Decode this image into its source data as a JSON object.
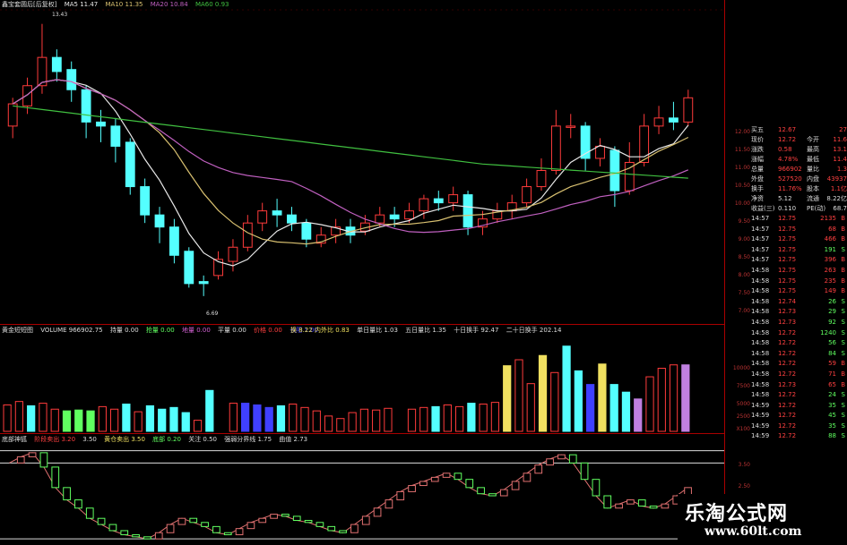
{
  "price_header": {
    "name": "鑫宝套圆后[后复权]",
    "ma5": "MA5 11.47",
    "ma10": "MA10 11.35",
    "ma20": "MA20 10.84",
    "ma60": "MA60 0.93",
    "high_label": "13.43",
    "low_label": "6.69"
  },
  "volume_header": {
    "name": "黄金短短图",
    "volume": "VOLUME 966902.75",
    "items": [
      "持量 0.00",
      "抢量 0.00",
      "地量 0.00",
      "平量 0.00",
      "价格 0.00",
      "长阳 1.00"
    ],
    "turnover": [
      "换手 8.72",
      "换 8.22 内外比 0.83",
      "单日量比 1.03",
      "五日量比 1.35",
      "十日换手 92.47",
      "二十日换手 202.14"
    ]
  },
  "indicator_header": {
    "name": "底部神狐",
    "items": [
      "阶段卖出 3.20",
      "3.50",
      "黄仓卖出 3.50",
      "底部 0.20",
      "关注 0.50",
      "强弱分界线 1.75",
      "曲值 2.73"
    ]
  },
  "axis": {
    "price_ticks": [
      "12.00",
      "11.50",
      "11.00",
      "10.50",
      "10.00",
      "9.50",
      "9.00",
      "8.50",
      "8.00",
      "7.50",
      "7.00"
    ],
    "volume_ticks": [
      "10000",
      "7500",
      "5000",
      "2500",
      "X100"
    ],
    "indicator_ticks": [
      "3.50",
      "2.50",
      "1.50"
    ]
  },
  "quote": [
    {
      "label": "买五",
      "val": "12.67",
      "right": "27"
    },
    {
      "label": "现价",
      "val": "12.72",
      "mid": "今开",
      "right": "11.6"
    },
    {
      "label": "涨跌",
      "val": "0.58",
      "mid": "最高",
      "right": "13.1"
    },
    {
      "label": "涨幅",
      "val": "4.78%",
      "mid": "最低",
      "right": "11.4"
    },
    {
      "label": "总量",
      "val": "966902",
      "mid": "量比",
      "right": "1.3"
    },
    {
      "label": "外盘",
      "val": "527520",
      "mid": "内盘",
      "right": "43937"
    },
    {
      "label": "换手",
      "val": "11.76%",
      "mid": "股本",
      "right": "1.1亿"
    },
    {
      "label": "净资",
      "val": "5.12",
      "mid": "流通",
      "right": "8.22亿"
    },
    {
      "label": "收益(三)",
      "val": "0.110",
      "mid": "PE(动)",
      "right": "68.7"
    }
  ],
  "ticks": [
    {
      "t": "14:57",
      "p": "12.75",
      "v": "2135",
      "s": "B"
    },
    {
      "t": "14:57",
      "p": "12.75",
      "v": "68",
      "s": "B"
    },
    {
      "t": "14:57",
      "p": "12.75",
      "v": "466",
      "s": "B"
    },
    {
      "t": "14:57",
      "p": "12.75",
      "v": "191",
      "s": "S"
    },
    {
      "t": "14:57",
      "p": "12.75",
      "v": "396",
      "s": "B"
    },
    {
      "t": "14:58",
      "p": "12.75",
      "v": "263",
      "s": "B"
    },
    {
      "t": "14:58",
      "p": "12.75",
      "v": "235",
      "s": "B"
    },
    {
      "t": "14:58",
      "p": "12.75",
      "v": "149",
      "s": "B"
    },
    {
      "t": "14:58",
      "p": "12.74",
      "v": "26",
      "s": "S"
    },
    {
      "t": "14:58",
      "p": "12.73",
      "v": "29",
      "s": "S"
    },
    {
      "t": "14:58",
      "p": "12.73",
      "v": "92",
      "s": "S"
    },
    {
      "t": "14:58",
      "p": "12.72",
      "v": "1240",
      "s": "S"
    },
    {
      "t": "14:58",
      "p": "12.72",
      "v": "56",
      "s": "S"
    },
    {
      "t": "14:58",
      "p": "12.72",
      "v": "84",
      "s": "S"
    },
    {
      "t": "14:58",
      "p": "12.72",
      "v": "59",
      "s": "B"
    },
    {
      "t": "14:58",
      "p": "12.72",
      "v": "71",
      "s": "B"
    },
    {
      "t": "14:58",
      "p": "12.73",
      "v": "65",
      "s": "B"
    },
    {
      "t": "14:58",
      "p": "12.72",
      "v": "24",
      "s": "S"
    },
    {
      "t": "14:59",
      "p": "12.72",
      "v": "35",
      "s": "S"
    },
    {
      "t": "14:59",
      "p": "12.72",
      "v": "45",
      "s": "S"
    },
    {
      "t": "14:59",
      "p": "12.72",
      "v": "35",
      "s": "S"
    },
    {
      "t": "14:59",
      "p": "12.72",
      "v": "88",
      "s": "S"
    }
  ],
  "watermark": {
    "line1": "乐淘公式网",
    "line2": "www.60lt.com"
  },
  "colors": {
    "up": "#ff3b3b",
    "down": "#54ffff",
    "ma5": "#e8e8e8",
    "ma10": "#d8c070",
    "ma20": "#c060c0",
    "ma60": "#40c040",
    "yellow": "#f0e060",
    "green": "#60ff60",
    "blue": "#4040ff",
    "purple": "#c080e0"
  },
  "candles": [
    [
      10.9,
      11.45,
      10.6,
      11.6
    ],
    [
      11.4,
      11.9,
      11.2,
      12.1
    ],
    [
      11.9,
      12.6,
      11.7,
      13.43
    ],
    [
      12.6,
      12.25,
      12.0,
      12.8
    ],
    [
      12.3,
      11.8,
      11.5,
      12.5
    ],
    [
      11.8,
      11.0,
      10.6,
      11.9
    ],
    [
      11.0,
      10.9,
      10.5,
      11.3
    ],
    [
      10.9,
      10.4,
      10.0,
      11.1
    ],
    [
      10.5,
      9.4,
      9.2,
      10.6
    ],
    [
      9.4,
      8.7,
      8.5,
      9.6
    ],
    [
      8.7,
      8.4,
      8.0,
      8.9
    ],
    [
      8.4,
      7.7,
      7.5,
      8.6
    ],
    [
      7.8,
      7.0,
      6.9,
      7.9
    ],
    [
      7.05,
      7.0,
      6.69,
      7.2
    ],
    [
      7.2,
      7.6,
      7.1,
      7.8
    ],
    [
      7.55,
      7.9,
      7.3,
      8.1
    ],
    [
      7.9,
      8.5,
      7.8,
      8.7
    ],
    [
      8.5,
      8.8,
      8.3,
      9.0
    ],
    [
      8.8,
      8.7,
      8.4,
      9.1
    ],
    [
      8.7,
      8.5,
      8.3,
      8.9
    ],
    [
      8.5,
      8.1,
      7.9,
      8.6
    ],
    [
      8.0,
      8.2,
      7.9,
      8.4
    ],
    [
      8.2,
      8.4,
      8.0,
      8.6
    ],
    [
      8.4,
      8.2,
      8.0,
      8.6
    ],
    [
      8.3,
      8.5,
      8.2,
      8.7
    ],
    [
      8.5,
      8.7,
      8.4,
      8.9
    ],
    [
      8.7,
      8.6,
      8.4,
      8.9
    ],
    [
      8.6,
      8.8,
      8.5,
      9.0
    ],
    [
      8.8,
      9.1,
      8.6,
      9.2
    ],
    [
      9.1,
      9.0,
      8.8,
      9.3
    ],
    [
      9.0,
      9.2,
      8.8,
      9.4
    ],
    [
      9.2,
      8.4,
      8.2,
      9.3
    ],
    [
      8.4,
      8.6,
      8.2,
      8.8
    ],
    [
      8.6,
      8.8,
      8.5,
      9.0
    ],
    [
      8.8,
      9.0,
      8.6,
      9.2
    ],
    [
      9.0,
      9.4,
      8.9,
      9.6
    ],
    [
      9.4,
      9.8,
      9.3,
      10.1
    ],
    [
      9.8,
      10.9,
      9.7,
      11.3
    ],
    [
      10.9,
      10.9,
      10.6,
      11.2
    ],
    [
      10.9,
      10.1,
      9.8,
      11.0
    ],
    [
      10.1,
      10.4,
      9.9,
      10.6
    ],
    [
      10.3,
      9.3,
      8.9,
      10.4
    ],
    [
      9.3,
      10.0,
      9.2,
      10.5
    ],
    [
      10.0,
      10.9,
      9.9,
      11.2
    ],
    [
      10.9,
      11.1,
      10.7,
      11.4
    ],
    [
      11.1,
      11.0,
      10.8,
      11.5
    ],
    [
      11.0,
      11.6,
      10.9,
      11.8
    ]
  ],
  "volumes": [
    [
      3.1,
      "up"
    ],
    [
      3.5,
      "up"
    ],
    [
      3.0,
      "down"
    ],
    [
      3.3,
      "up"
    ],
    [
      2.6,
      "up"
    ],
    [
      2.4,
      "green"
    ],
    [
      2.5,
      "green"
    ],
    [
      2.4,
      "green"
    ],
    [
      2.9,
      "up"
    ],
    [
      2.6,
      "up"
    ],
    [
      3.2,
      "down"
    ],
    [
      2.3,
      "up"
    ],
    [
      3.0,
      "down"
    ],
    [
      2.6,
      "down"
    ],
    [
      2.8,
      "down"
    ],
    [
      2.2,
      "down"
    ],
    [
      1.3,
      "up"
    ],
    [
      4.8,
      "down"
    ],
    [
      3.1,
      "white"
    ],
    [
      3.3,
      "up"
    ],
    [
      3.3,
      "blue"
    ],
    [
      3.1,
      "blue"
    ],
    [
      2.8,
      "blue"
    ],
    [
      3.0,
      "down"
    ],
    [
      3.2,
      "up"
    ],
    [
      2.8,
      "up"
    ],
    [
      2.4,
      "up"
    ],
    [
      1.8,
      "up"
    ],
    [
      1.5,
      "up"
    ],
    [
      2.2,
      "up"
    ],
    [
      2.6,
      "up"
    ],
    [
      2.5,
      "up"
    ],
    [
      2.7,
      "up"
    ],
    [
      3.0,
      "white"
    ],
    [
      2.6,
      "up"
    ],
    [
      2.8,
      "up"
    ],
    [
      2.9,
      "down"
    ],
    [
      3.1,
      "up"
    ],
    [
      2.9,
      "up"
    ],
    [
      3.3,
      "down"
    ],
    [
      3.2,
      "up"
    ],
    [
      3.4,
      "up"
    ],
    [
      7.7,
      "yellow"
    ],
    [
      8.4,
      "up"
    ],
    [
      5.6,
      "up"
    ],
    [
      8.9,
      "yellow"
    ],
    [
      6.9,
      "up"
    ],
    [
      10.0,
      "down"
    ],
    [
      7.1,
      "down"
    ],
    [
      5.5,
      "blue"
    ],
    [
      7.9,
      "yellow"
    ],
    [
      5.5,
      "down"
    ],
    [
      4.6,
      "down"
    ],
    [
      3.8,
      "purple"
    ],
    [
      6.4,
      "up"
    ],
    [
      7.4,
      "up"
    ],
    [
      7.8,
      "up"
    ],
    [
      7.8,
      "purple"
    ]
  ],
  "indicator": [
    3.2,
    3.35,
    3.45,
    3.1,
    2.6,
    2.3,
    2.1,
    1.85,
    1.7,
    1.55,
    1.45,
    1.4,
    1.35,
    1.5,
    1.7,
    1.85,
    1.75,
    1.65,
    1.5,
    1.45,
    1.6,
    1.75,
    1.85,
    1.95,
    1.9,
    1.8,
    1.75,
    1.65,
    1.55,
    1.5,
    1.7,
    1.9,
    2.1,
    2.3,
    2.5,
    2.65,
    2.75,
    2.85,
    2.95,
    2.8,
    2.6,
    2.45,
    2.4,
    2.55,
    2.75,
    2.95,
    3.15,
    3.3,
    3.4,
    3.2,
    2.8,
    2.4,
    2.1,
    2.2,
    2.3,
    2.15,
    2.1,
    2.2,
    2.4,
    2.6
  ]
}
